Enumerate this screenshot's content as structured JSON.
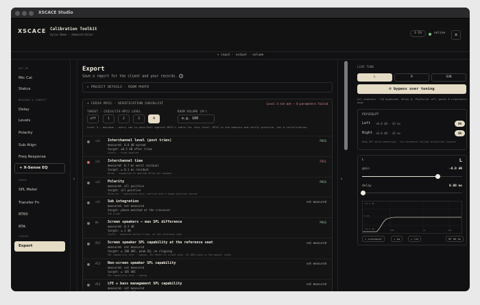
{
  "window": {
    "title": "XSCACE Studio"
  },
  "header": {
    "logo": "XSCACE",
    "title": "Calibration Toolkit",
    "subtitle": "Sylon Demo · demonstration",
    "channel_pill": "3 CH",
    "status": "online",
    "status_color": "#7ec88a"
  },
  "breadcrumb": "▾ input · output · volume",
  "sidebar": {
    "sections": [
      {
        "label": "SET UP",
        "items": [
          "Mic Cal",
          "Status"
        ]
      },
      {
        "label": "MEASURE & CORRECT",
        "items": [
          "Delay",
          "Levels",
          "Polarity",
          "Sub Align",
          "Freq Response",
          "+ X-Sense EQ"
        ]
      },
      {
        "label": "CHECK",
        "items": [
          "SPL Meter",
          "Transfer Fn",
          "RT60",
          "RTA"
        ]
      },
      {
        "label": "FINISH",
        "items": [
          "Export"
        ]
      }
    ],
    "active": "Export"
  },
  "main": {
    "title": "Export",
    "lead": "Save a report for the client and your records.",
    "collapsed_section": "▸ PROJECT DETAILS · ROOM PHOTO",
    "checklist": {
      "header": "▾ CEDIA RP22 · VERIFICATION CHECKLIST",
      "warning": "Level 4 not met — 8 parameters failed",
      "target_label": "TARGET · CEDIA/CTA-RP22 LEVEL",
      "room_label": "ROOM VOLUME (M³)",
      "levels": [
        "off",
        "1",
        "2",
        "3",
        "4"
      ],
      "selected_level": "4",
      "room_value": "e.g. 100",
      "description": "Level 4 — maximum — every row is pass/fail against RP22's table for this level. RP22 is the measure-and-verify practice, not a certification.",
      "items": [
        {
          "code": "cal",
          "title": "Interchannel level (post trims)",
          "status": "PASS",
          "lines": [
            "measured: 0.8 dB spread",
            "target: ±0.5 dB after trims"
          ],
          "note": "Levels · trims applied"
        },
        {
          "code": "cal",
          "title": "Interchannel time",
          "status": "FAIL",
          "lines": [
            "measured: 0.7 ms worst residual",
            "target: ≤ 0.1 ms residual"
          ],
          "note": "Delay · suggested vs applied delay per speaker"
        },
        {
          "code": "cal",
          "title": "Polarity",
          "status": "PASS",
          "lines": [
            "measured: all positive",
            "target: all positive"
          ],
          "note": "Polarity · indicative only; confirm with a known-polarity source"
        },
        {
          "code": "cal",
          "title": "Sub integration",
          "status": "not measured",
          "lines": [
            "measured: not measured",
            "target: phase-matched at the crossover"
          ],
          "note": "Sub Align"
        },
        {
          "code": "8%",
          "title": "Screen speakers — max SPL difference",
          "status": "PASS",
          "lines": [
            "measured: 0.3 dB",
            "target: ≤ 2 dB"
          ],
          "note": "Levels · measured before trims, at the reference seat"
        },
        {
          "code": "#12",
          "title": "Screen speaker SPL capability at the reference seat",
          "status": "not measured",
          "lines": [
            "measured: not measured",
            "target: ≥ 108 dBC, peak EQ, no clipping"
          ],
          "note": "SPL capability test · coming. SPL Meter CL client with -20 dBFS pink is the manual route"
        },
        {
          "code": "#13",
          "title": "Non-screen speaker SPL capability",
          "status": "not measured",
          "lines": [
            "measured: not measured",
            "target: ≥ 105 dBC"
          ],
          "note": "SPL capability test · coming"
        },
        {
          "code": "#14",
          "title": "LFE + bass management SPL capability",
          "status": "not measured",
          "lines": [
            "measured: not measured",
            "target: ≥ 118 dBC"
          ],
          "note": "SPL capability test · coming"
        }
      ]
    }
  },
  "right": {
    "section": "LIVE TUNE",
    "channels": [
      "L",
      "R",
      "SUB"
    ],
    "selected_channel": "L",
    "bypass_label": "⊘ bypass user tuning",
    "note": "all channels · EQ bypassed, delay 0, PsySculpt off; gains & crossovers kept",
    "psysculpt": {
      "title": "PSYSCULPT",
      "rows": [
        {
          "label": "Left",
          "value": "+0.0 dB · 42 ms",
          "toggle": "ON"
        },
        {
          "label": "Right",
          "value": "+0.0 dB · 42 ms",
          "toggle": "ON"
        }
      ],
      "note": "Keep OFF while measuring · its harmonics corrupt distortion figures"
    },
    "editor": {
      "channel": "L",
      "channel_big": "L",
      "gain_label": "gain",
      "gain_value": "-0.0 dB",
      "gain_fraction": 0.75,
      "delay_label": "delay",
      "delay_value": "0.00 ms",
      "delay_fraction": 0.0,
      "graph_labels": {
        "top": "+24.0 dB",
        "mid": "0 dB",
        "bottom": "-24.0 dB",
        "x1": "100",
        "x2": "1k",
        "x3": "10k"
      },
      "buttons": [
        "+ crossover",
        "+ eq",
        "+ lin",
        "HP 80 Hz"
      ]
    }
  }
}
